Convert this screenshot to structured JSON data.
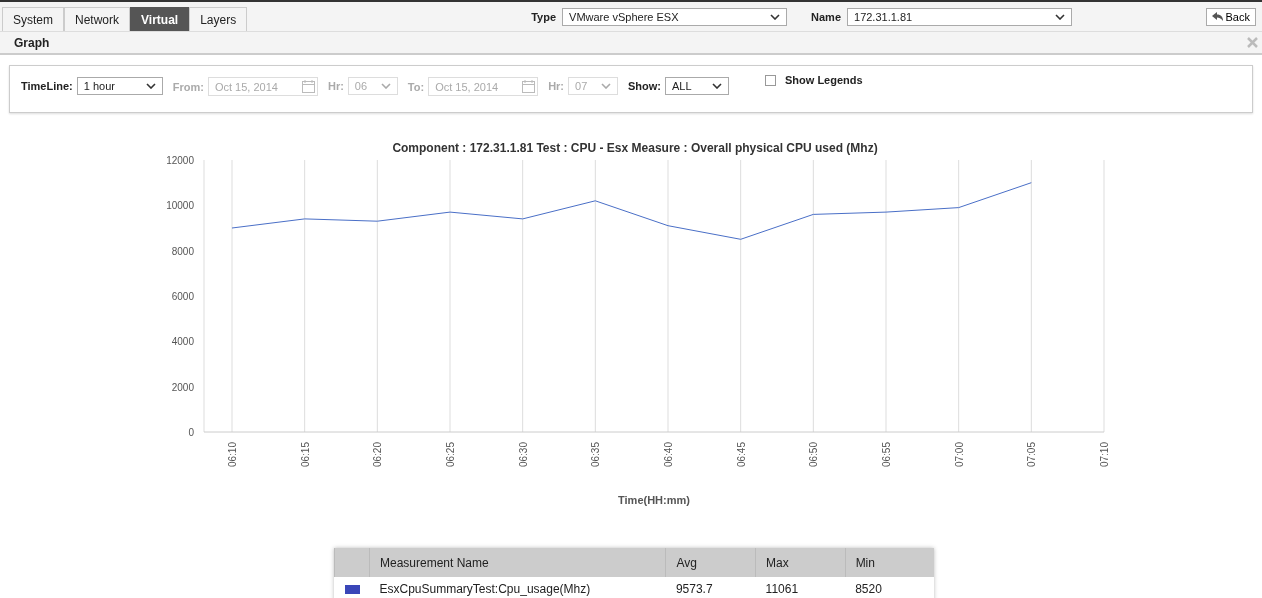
{
  "tabs": [
    {
      "label": "System",
      "selected": false
    },
    {
      "label": "Network",
      "selected": false
    },
    {
      "label": "Virtual",
      "selected": true
    },
    {
      "label": "Layers",
      "selected": false
    }
  ],
  "type_field": {
    "label": "Type",
    "value": "VMware vSphere ESX"
  },
  "name_field": {
    "label": "Name",
    "value": "172.31.1.81"
  },
  "back_button": "Back",
  "panel": {
    "title": "Graph"
  },
  "filters": {
    "timeline": {
      "label": "TimeLine:",
      "value": "1 hour"
    },
    "from": {
      "label": "From:",
      "value": "Oct 15, 2014",
      "disabled": true
    },
    "from_hr": {
      "label": "Hr:",
      "value": "06",
      "disabled": true
    },
    "to": {
      "label": "To:",
      "value": "Oct 15, 2014",
      "disabled": true
    },
    "to_hr": {
      "label": "Hr:",
      "value": "07",
      "disabled": true
    },
    "show": {
      "label": "Show:",
      "value": "ALL"
    },
    "show_legends": {
      "label": "Show Legends",
      "checked": false
    }
  },
  "chart": {
    "chart_data": {
      "type": "line",
      "title": "Component : 172.31.1.81 Test : CPU - Esx Measure : Overall physical CPU used (Mhz)",
      "xlabel": "Time(HH:mm)",
      "categories": [
        "06:10",
        "06:15",
        "06:20",
        "06:25",
        "06:30",
        "06:35",
        "06:40",
        "06:45",
        "06:50",
        "06:55",
        "07:00",
        "07:05",
        "07:10"
      ],
      "series": [
        {
          "color": "#4a6fc7",
          "values": [
            9000,
            9400,
            9300,
            9700,
            9400,
            10200,
            9100,
            8500,
            9600,
            9700,
            9900,
            11000,
            null
          ]
        }
      ],
      "ylim": [
        0,
        12000
      ],
      "grid": true,
      "yticks": [
        0,
        2000,
        4000,
        6000,
        8000,
        10000,
        12000
      ]
    }
  },
  "table": {
    "columns": [
      "Measurement Name",
      "Avg",
      "Max",
      "Min"
    ],
    "rows": [
      {
        "color": "#3a46b8",
        "cells": [
          "EsxCpuSummaryTest:Cpu_usage(Mhz)",
          "9573.7",
          "11061",
          "8520"
        ]
      }
    ]
  }
}
